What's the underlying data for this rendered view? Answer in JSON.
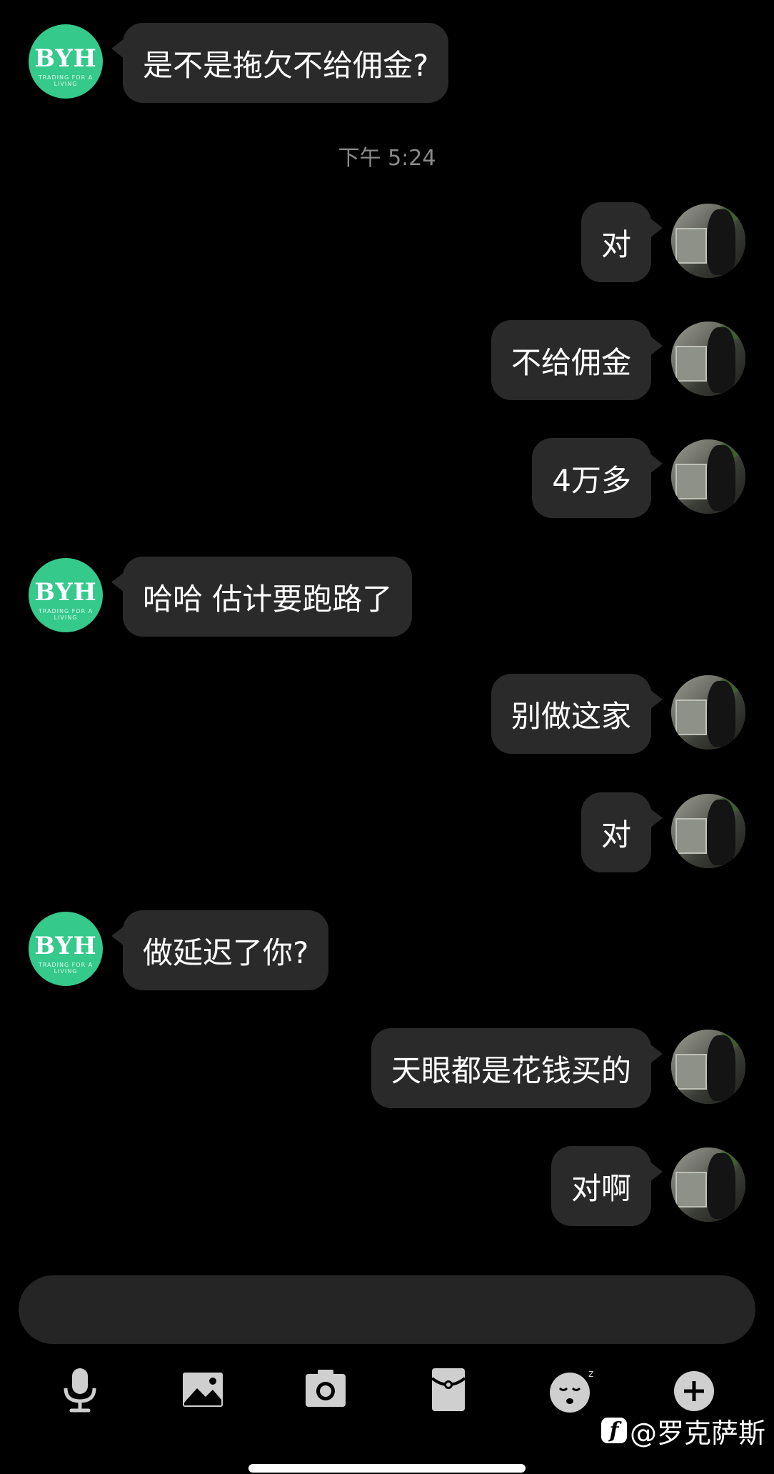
{
  "chat": {
    "timestamp": "下午 5:24",
    "contact_avatar": {
      "letters": "BYH",
      "tagline": "TRADING FOR A LIVING",
      "color": "#35c98b"
    },
    "messages": [
      {
        "side": "left",
        "text": "是不是拖欠不给佣金?"
      },
      {
        "side": "right",
        "text": "对"
      },
      {
        "side": "right",
        "text": "不给佣金"
      },
      {
        "side": "right",
        "text": "4万多"
      },
      {
        "side": "left",
        "text": "哈哈 估计要跑路了"
      },
      {
        "side": "right",
        "text": "别做这家"
      },
      {
        "side": "right",
        "text": "对"
      },
      {
        "side": "left",
        "text": "做延迟了你?"
      },
      {
        "side": "right",
        "text": "天眼都是花钱买的"
      },
      {
        "side": "right",
        "text": "对啊"
      }
    ]
  },
  "input": {
    "value": "",
    "placeholder": ""
  },
  "toolbar": {
    "items": [
      {
        "name": "microphone-icon"
      },
      {
        "name": "image-icon"
      },
      {
        "name": "camera-icon"
      },
      {
        "name": "red-packet-icon"
      },
      {
        "name": "emoji-icon"
      },
      {
        "name": "plus-icon"
      }
    ]
  },
  "watermark": {
    "logo": "f",
    "text": "@罗克萨斯"
  },
  "colors": {
    "background": "#000000",
    "bubble": "#2a2a2a",
    "input": "#252525",
    "icon": "#cfcfcf"
  }
}
